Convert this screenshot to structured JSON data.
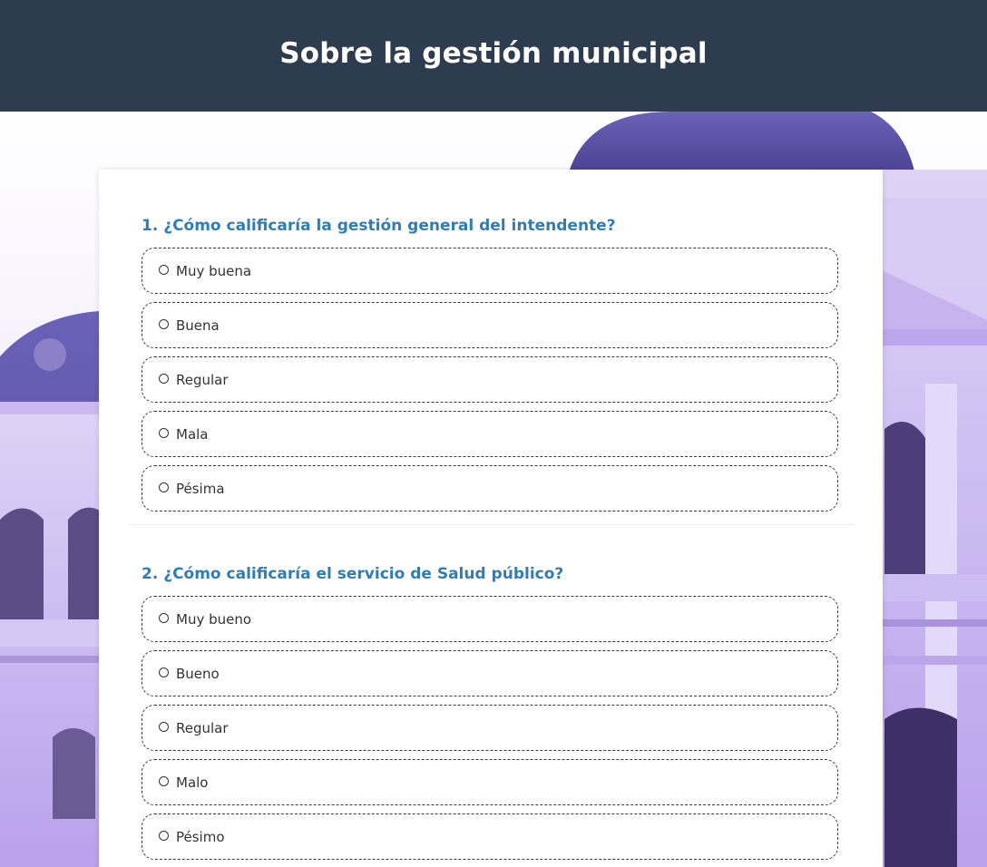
{
  "header": {
    "title": "Sobre la gestión municipal"
  },
  "survey": {
    "questions": [
      {
        "title": "1. ¿Cómo calificaría la gestión general del intendente?",
        "options": [
          "Muy buena",
          "Buena",
          "Regular",
          "Mala",
          "Pésima"
        ]
      },
      {
        "title": "2. ¿Cómo calificaría el servicio de Salud público?",
        "options": [
          "Muy bueno",
          "Bueno",
          "Regular",
          "Malo",
          "Pésimo"
        ]
      }
    ]
  },
  "colors": {
    "header_bg": "#2d3c4f",
    "question_title": "#2f7db2",
    "photo_tint": "#9b7fe0"
  }
}
